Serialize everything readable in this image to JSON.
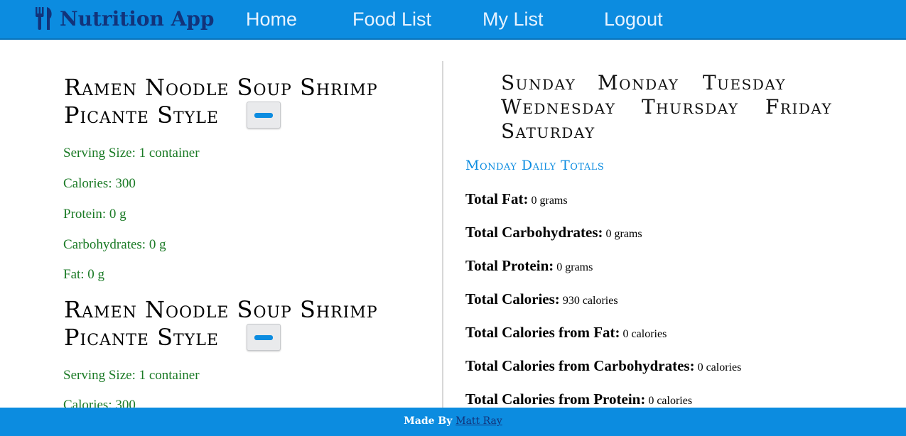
{
  "nav": {
    "brand": "Nutrition App",
    "brand_icon": "utensils-icon",
    "links": [
      "Home",
      "Food List",
      "My List",
      "Logout"
    ]
  },
  "foods": [
    {
      "name": "Ramen Noodle Soup Shrimp Picante Style",
      "serving": "Serving Size: 1 container",
      "calories": "Calories: 300",
      "protein": "Protein: 0 g",
      "carbs": "Carbohydrates: 0 g",
      "fat": "Fat: 0 g"
    },
    {
      "name": "Ramen Noodle Soup Shrimp Picante Style",
      "serving": "Serving Size: 1 container",
      "calories": "Calories: 300"
    }
  ],
  "days": [
    "Sunday",
    "Monday",
    "Tuesday",
    "Wednesday",
    "Thursday",
    "Friday",
    "Saturday"
  ],
  "totals": {
    "heading": "Monday Daily Totals",
    "rows": [
      {
        "label": "Total Fat:",
        "value": "0 grams"
      },
      {
        "label": "Total Carbohydrates:",
        "value": "0 grams"
      },
      {
        "label": "Total Protein:",
        "value": "0 grams"
      },
      {
        "label": "Total Calories:",
        "value": "930 calories"
      },
      {
        "label": "Total Calories from Fat:",
        "value": "0 calories"
      },
      {
        "label": "Total Calories from Carbohydrates:",
        "value": "0 calories"
      },
      {
        "label": "Total Calories from Protein:",
        "value": "0 calories"
      }
    ]
  },
  "footer": {
    "prefix": "Made By",
    "author": "Matt Ray"
  },
  "colors": {
    "primary": "#0c8ce0",
    "brand_text": "#12337a",
    "food_text": "#1a7a25"
  }
}
